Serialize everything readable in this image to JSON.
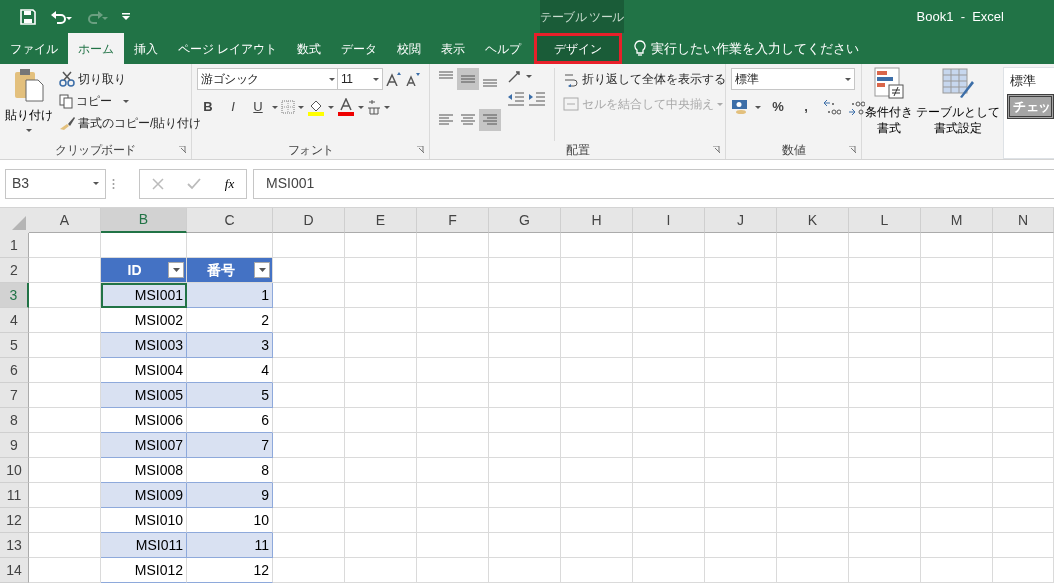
{
  "title_bar": {
    "context_label": "テーブル ツール",
    "title": "Book1  -  Excel"
  },
  "tabs": [
    {
      "label": "ファイル",
      "selected": false,
      "highlighted": false,
      "kind": "normal"
    },
    {
      "label": "ホーム",
      "selected": true,
      "highlighted": false,
      "kind": "normal"
    },
    {
      "label": "挿入",
      "selected": false,
      "highlighted": false,
      "kind": "normal"
    },
    {
      "label": "ページ レイアウト",
      "selected": false,
      "highlighted": false,
      "kind": "normal"
    },
    {
      "label": "数式",
      "selected": false,
      "highlighted": false,
      "kind": "normal"
    },
    {
      "label": "データ",
      "selected": false,
      "highlighted": false,
      "kind": "normal"
    },
    {
      "label": "校閲",
      "selected": false,
      "highlighted": false,
      "kind": "normal"
    },
    {
      "label": "表示",
      "selected": false,
      "highlighted": false,
      "kind": "normal"
    },
    {
      "label": "ヘルプ",
      "selected": false,
      "highlighted": false,
      "kind": "normal"
    },
    {
      "label": "デザイン",
      "selected": false,
      "highlighted": true,
      "kind": "contextual"
    }
  ],
  "tell_me": "実行したい作業を入力してください",
  "ribbon": {
    "clipboard": {
      "label": "クリップボード",
      "paste": "貼り付け",
      "cut": "切り取り",
      "copy": "コピー",
      "format_painter": "書式のコピー/貼り付け"
    },
    "font": {
      "label": "フォント",
      "font_name": "游ゴシック",
      "font_size": "11",
      "style_buttons": [
        "B",
        "I",
        "U"
      ]
    },
    "alignment": {
      "label": "配置",
      "align_buttons": [
        {
          "kind": "top",
          "selected": false
        },
        {
          "kind": "middle",
          "selected": true
        },
        {
          "kind": "bottom",
          "selected": false
        },
        {
          "kind": "left",
          "selected": false
        },
        {
          "kind": "center",
          "selected": false
        },
        {
          "kind": "right",
          "selected": true
        }
      ],
      "wrap_text": "折り返して全体を表示する",
      "merge": "セルを結合して中央揃え",
      "merge_disabled": true
    },
    "number": {
      "label": "数値",
      "format": "標準",
      "percent": "%",
      "comma": ","
    },
    "styles": {
      "conditional_format": [
        "条件付き",
        "書式"
      ],
      "format_as_table": [
        "テーブルとして",
        "書式設定"
      ],
      "cell_styles": [
        "標準",
        "チェッ"
      ]
    }
  },
  "formula_bar": {
    "name_box": "B3",
    "fx": "fx",
    "formula": "MSI001"
  },
  "sheet": {
    "columns": [
      {
        "label": "A",
        "selected": false
      },
      {
        "label": "B",
        "selected": true
      },
      {
        "label": "C",
        "selected": false
      },
      {
        "label": "D",
        "selected": false
      },
      {
        "label": "E",
        "selected": false
      },
      {
        "label": "F",
        "selected": false
      },
      {
        "label": "G",
        "selected": false
      },
      {
        "label": "H",
        "selected": false
      },
      {
        "label": "I",
        "selected": false
      },
      {
        "label": "J",
        "selected": false
      },
      {
        "label": "K",
        "selected": false
      },
      {
        "label": "L",
        "selected": false
      },
      {
        "label": "M",
        "selected": false
      },
      {
        "label": "N",
        "selected": false
      }
    ],
    "rows": [
      {
        "number": "1",
        "selected": false,
        "kind": "empty"
      },
      {
        "number": "2",
        "selected": false,
        "kind": "header",
        "cells": [
          {
            "text": "ID",
            "active": false
          },
          {
            "text": "番号",
            "active": false
          }
        ]
      },
      {
        "number": "3",
        "selected": true,
        "kind": "data",
        "banded": true,
        "cells": [
          {
            "text": "MSI001",
            "active": true
          },
          {
            "text": "1",
            "active": false
          }
        ]
      },
      {
        "number": "4",
        "selected": false,
        "kind": "data",
        "banded": false,
        "cells": [
          {
            "text": "MSI002",
            "active": false
          },
          {
            "text": "2",
            "active": false
          }
        ]
      },
      {
        "number": "5",
        "selected": false,
        "kind": "data",
        "banded": true,
        "cells": [
          {
            "text": "MSI003",
            "active": false
          },
          {
            "text": "3",
            "active": false
          }
        ]
      },
      {
        "number": "6",
        "selected": false,
        "kind": "data",
        "banded": false,
        "cells": [
          {
            "text": "MSI004",
            "active": false
          },
          {
            "text": "4",
            "active": false
          }
        ]
      },
      {
        "number": "7",
        "selected": false,
        "kind": "data",
        "banded": true,
        "cells": [
          {
            "text": "MSI005",
            "active": false
          },
          {
            "text": "5",
            "active": false
          }
        ]
      },
      {
        "number": "8",
        "selected": false,
        "kind": "data",
        "banded": false,
        "cells": [
          {
            "text": "MSI006",
            "active": false
          },
          {
            "text": "6",
            "active": false
          }
        ]
      },
      {
        "number": "9",
        "selected": false,
        "kind": "data",
        "banded": true,
        "cells": [
          {
            "text": "MSI007",
            "active": false
          },
          {
            "text": "7",
            "active": false
          }
        ]
      },
      {
        "number": "10",
        "selected": false,
        "kind": "data",
        "banded": false,
        "cells": [
          {
            "text": "MSI008",
            "active": false
          },
          {
            "text": "8",
            "active": false
          }
        ]
      },
      {
        "number": "11",
        "selected": false,
        "kind": "data",
        "banded": true,
        "cells": [
          {
            "text": "MSI009",
            "active": false
          },
          {
            "text": "9",
            "active": false
          }
        ]
      },
      {
        "number": "12",
        "selected": false,
        "kind": "data",
        "banded": false,
        "cells": [
          {
            "text": "MSI010",
            "active": false
          },
          {
            "text": "10",
            "active": false
          }
        ]
      },
      {
        "number": "13",
        "selected": false,
        "kind": "data",
        "banded": true,
        "cells": [
          {
            "text": "MSI011",
            "active": false
          },
          {
            "text": "11",
            "active": false
          }
        ]
      },
      {
        "number": "14",
        "selected": false,
        "kind": "data",
        "banded": false,
        "cells": [
          {
            "text": "MSI012",
            "active": false
          },
          {
            "text": "12",
            "active": false
          }
        ]
      }
    ]
  }
}
